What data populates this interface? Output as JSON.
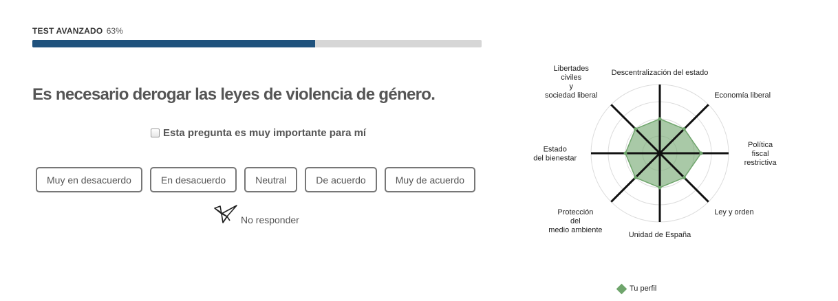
{
  "progress": {
    "title": "TEST AVANZADO",
    "percent_label": "63%",
    "fraction": 0.63,
    "fill_color": "#1f527d",
    "track_color": "#d6d6d6"
  },
  "question": {
    "text": "Es necesario derogar las leyes de violencia de género."
  },
  "importance": {
    "label": "Esta pregunta es muy importante para mí",
    "checked": false
  },
  "answers": [
    {
      "label": "Muy en desacuerdo"
    },
    {
      "label": "En desacuerdo"
    },
    {
      "label": "Neutral"
    },
    {
      "label": "De acuerdo"
    },
    {
      "label": "Muy de acuerdo"
    }
  ],
  "skip": {
    "label": "No responder",
    "icon": "origami-bird-icon"
  },
  "chart_data": {
    "type": "radar",
    "axes": [
      {
        "lines": [
          "Descentralización del estado"
        ]
      },
      {
        "lines": [
          "Economía liberal"
        ]
      },
      {
        "lines": [
          "Política",
          "fiscal",
          "restrictiva"
        ]
      },
      {
        "lines": [
          "Ley y orden"
        ]
      },
      {
        "lines": [
          "Unidad de España"
        ]
      },
      {
        "lines": [
          "Protección",
          "del",
          "medio ambiente"
        ]
      },
      {
        "lines": [
          "Estado",
          "del bienestar"
        ]
      },
      {
        "lines": [
          "Libertades",
          "civiles",
          "y",
          "sociedad liberal"
        ]
      }
    ],
    "series": [
      {
        "name": "Tu perfil",
        "values": [
          0.5,
          0.5,
          0.6,
          0.5,
          0.5,
          0.5,
          0.5,
          0.5
        ],
        "color": "#6fa56c"
      }
    ],
    "max": 1,
    "rings": 4
  }
}
